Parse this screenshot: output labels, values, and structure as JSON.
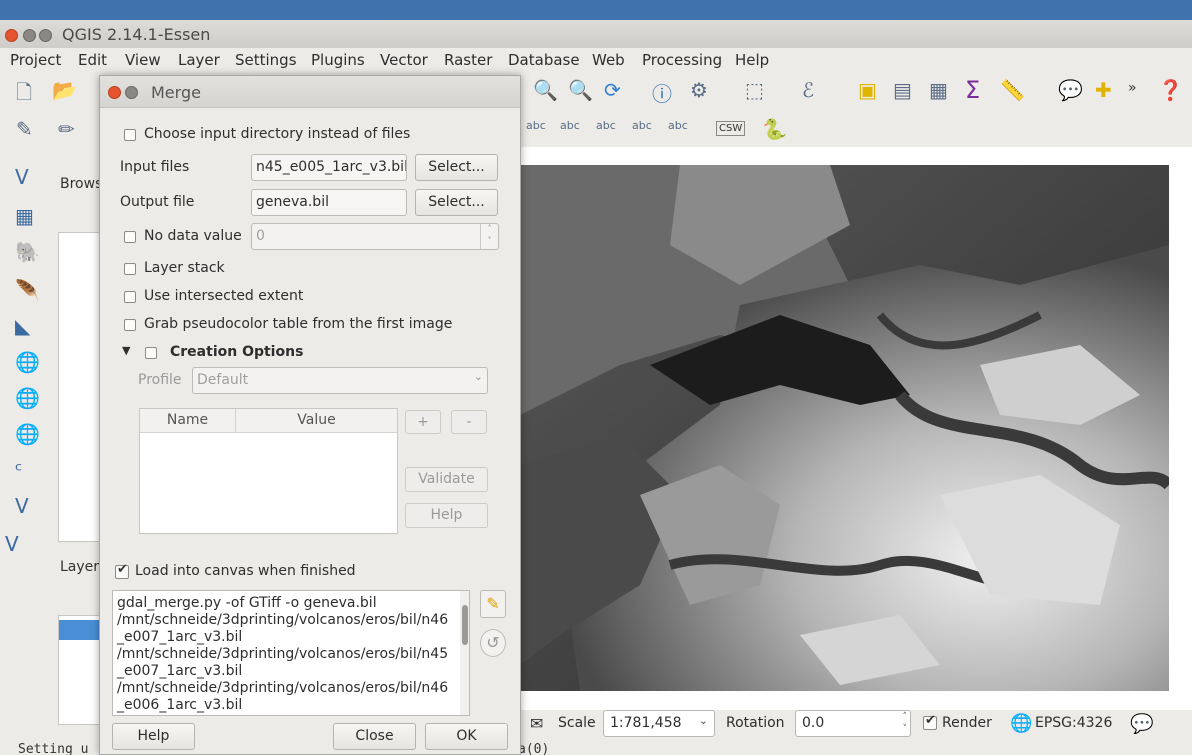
{
  "window": {
    "title": "QGIS 2.14.1-Essen"
  },
  "menu": [
    "Project",
    "Edit",
    "View",
    "Layer",
    "Settings",
    "Plugins",
    "Vector",
    "Raster",
    "Database",
    "Web",
    "Processing",
    "Help"
  ],
  "panels": {
    "browser_label": "Brows",
    "layers_label": "Layers"
  },
  "status": {
    "scale_label": "Scale",
    "scale_value": "1:781,458",
    "rotation_label": "Rotation",
    "rotation_value": "0.0",
    "render_label": "Render",
    "crs": "EPSG:4326",
    "console_left": "Setting u",
    "console_right": "a(0) ..."
  },
  "toolbar2_labels": {
    "csw": "CSW"
  },
  "dialog": {
    "title": "Merge",
    "choose_dir_label": "Choose input directory instead of files",
    "input_files_label": "Input files",
    "input_files_value": "n45_e005_1arc_v3.bil",
    "output_file_label": "Output file",
    "output_file_value": "geneva.bil",
    "select_label": "Select...",
    "no_data_label": "No data value",
    "no_data_value": "0",
    "layer_stack_label": "Layer stack",
    "intersected_label": "Use intersected extent",
    "pseudocolor_label": "Grab pseudocolor table from the first image",
    "creation_options_label": "Creation Options",
    "profile_label": "Profile",
    "profile_value": "Default",
    "table_headers": [
      "Name",
      "Value"
    ],
    "plus_label": "+",
    "minus_label": "-",
    "validate_label": "Validate",
    "help_small_label": "Help",
    "load_canvas_label": "Load into canvas when finished",
    "command_lines": [
      "gdal_merge.py -of GTiff -o geneva.bil",
      "/mnt/schneide/3dprinting/volcanos/eros/bil/n46",
      "_e007_1arc_v3.bil",
      "/mnt/schneide/3dprinting/volcanos/eros/bil/n45",
      "_e007_1arc_v3.bil",
      "/mnt/schneide/3dprinting/volcanos/eros/bil/n46",
      "_e006_1arc_v3.bil"
    ],
    "help_label": "Help",
    "close_label": "Close",
    "ok_label": "OK"
  }
}
